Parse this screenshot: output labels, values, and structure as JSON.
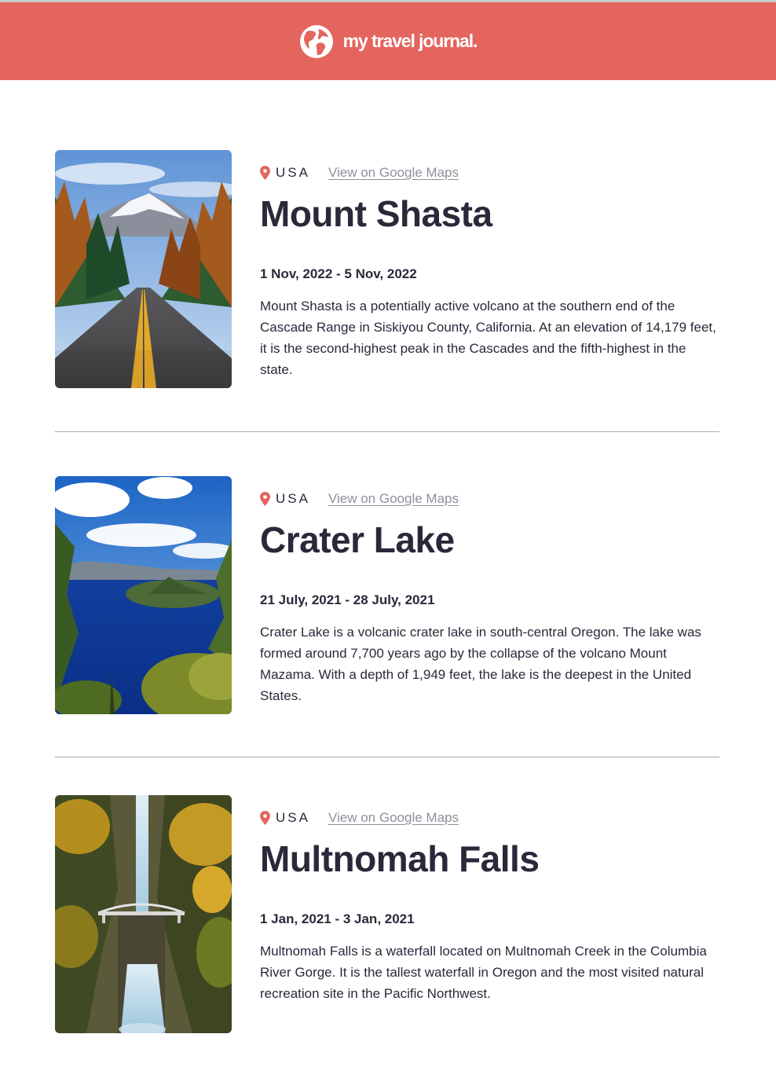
{
  "header": {
    "title": "my travel journal.",
    "icon": "globe-icon",
    "background": "#E3655E"
  },
  "entries": [
    {
      "country": "USA",
      "maps_link": "View on Google Maps",
      "title": "Mount Shasta",
      "dates": "1 Nov, 2022 - 5 Nov, 2022",
      "description": "Mount Shasta is a potentially active volcano at the southern end of the Cascade Range in Siskiyou County, California. At an elevation of 14,179 feet, it is the second-highest peak in the Cascades and the fifth-highest in the state."
    },
    {
      "country": "USA",
      "maps_link": "View on Google Maps",
      "title": "Crater Lake",
      "dates": "21 July, 2021 - 28 July, 2021",
      "description": "Crater Lake is a volcanic crater lake in south-central Oregon. The lake was formed around 7,700 years ago by the collapse of the volcano Mount Mazama. With a depth of 1,949 feet, the lake is the deepest in the United States."
    },
    {
      "country": "USA",
      "maps_link": "View on Google Maps",
      "title": "Multnomah Falls",
      "dates": "1 Jan, 2021 - 3 Jan, 2021",
      "description": "Multnomah Falls is a waterfall located on Multnomah Creek in the Columbia River Gorge. It is the tallest waterfall in Oregon and the most visited natural recreation site in the Pacific Northwest."
    }
  ],
  "colors": {
    "accent": "#E3655E",
    "text": "#2B283A",
    "muted": "#918E9B"
  }
}
